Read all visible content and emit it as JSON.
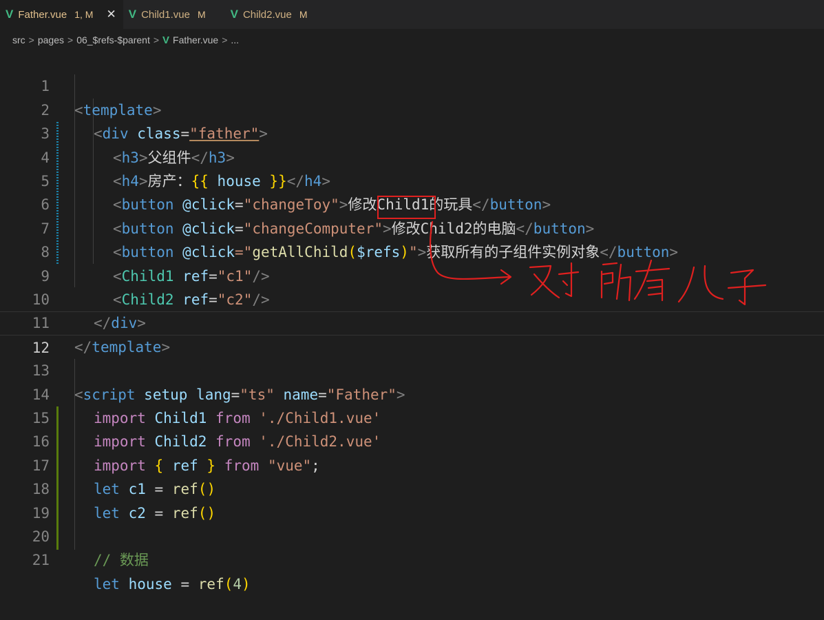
{
  "tabs": [
    {
      "name": "Father.vue",
      "status": "1, M",
      "active": true
    },
    {
      "name": "Child1.vue",
      "status": "M",
      "active": false
    },
    {
      "name": "Child2.vue",
      "status": "M",
      "active": false
    }
  ],
  "tab_icon": "V",
  "close_glyph": "✕",
  "breadcrumb": {
    "items": [
      "src",
      "pages",
      "06_$refs-$parent",
      "Father.vue",
      "..."
    ],
    "separator": ">",
    "file_icon": "V"
  },
  "line_numbers": [
    "1",
    "2",
    "3",
    "4",
    "5",
    "6",
    "7",
    "8",
    "9",
    "10",
    "11",
    "12",
    "13",
    "14",
    "15",
    "16",
    "17",
    "18",
    "19",
    "20",
    "21"
  ],
  "current_line": "12",
  "code": {
    "l1": [
      "<",
      "template",
      ">"
    ],
    "l2": [
      "<",
      "div",
      "class",
      "=",
      "\"father\"",
      ">"
    ],
    "l3": [
      "<",
      "h3",
      ">",
      "父组件",
      "</",
      "h3",
      ">"
    ],
    "l4": [
      "<",
      "h4",
      ">",
      "房产：",
      "{{",
      " house ",
      "}}",
      "</",
      "h4",
      ">"
    ],
    "l5": [
      "<",
      "button",
      "@click",
      "=",
      "\"changeToy\"",
      ">",
      "修改Child1的玩具",
      "</",
      "button",
      ">"
    ],
    "l6": [
      "<",
      "button",
      "@click",
      "=",
      "\"changeComputer\"",
      ">",
      "修改Child2的电脑",
      "</",
      "button",
      ">"
    ],
    "l7": [
      "<",
      "button",
      "@click",
      "=\"",
      "getAllChild",
      "(",
      "$refs",
      ")",
      "\"",
      ">",
      "获取所有的子组件实例对象",
      "</",
      "button",
      ">"
    ],
    "l8": [
      "<",
      "Child1",
      "ref",
      "=",
      "\"c1\"",
      "/>"
    ],
    "l9": [
      "<",
      "Child2",
      "ref",
      "=",
      "\"c2\"",
      "/>"
    ],
    "l10": [
      "</",
      "div",
      ">"
    ],
    "l11": [
      "</",
      "template",
      ">"
    ],
    "l13": [
      "<",
      "script",
      "setup",
      "lang",
      "=",
      "\"ts\"",
      "name",
      "=",
      "\"Father\"",
      ">"
    ],
    "l14": [
      "import",
      "Child1",
      "from",
      "'./Child1.vue'"
    ],
    "l15": [
      "import",
      "Child2",
      "from",
      "'./Child2.vue'"
    ],
    "l16": [
      "import",
      "{",
      " ref ",
      "}",
      "from",
      "\"vue\"",
      ";"
    ],
    "l17": [
      "let",
      "c1",
      "=",
      "ref",
      "()"
    ],
    "l18": [
      "let",
      "c2",
      "=",
      "ref",
      "()"
    ],
    "l20": [
      "// 数据"
    ],
    "l21": [
      "let",
      "house",
      "=",
      "ref",
      "(",
      "4",
      ")"
    ]
  },
  "annotation": {
    "handwritten_text": "对所有儿子",
    "color": "#e0201f"
  },
  "colors": {
    "background": "#1e1e1e",
    "tabbar": "#252526",
    "vue_green": "#41b883",
    "modified": "#e2c08d"
  }
}
